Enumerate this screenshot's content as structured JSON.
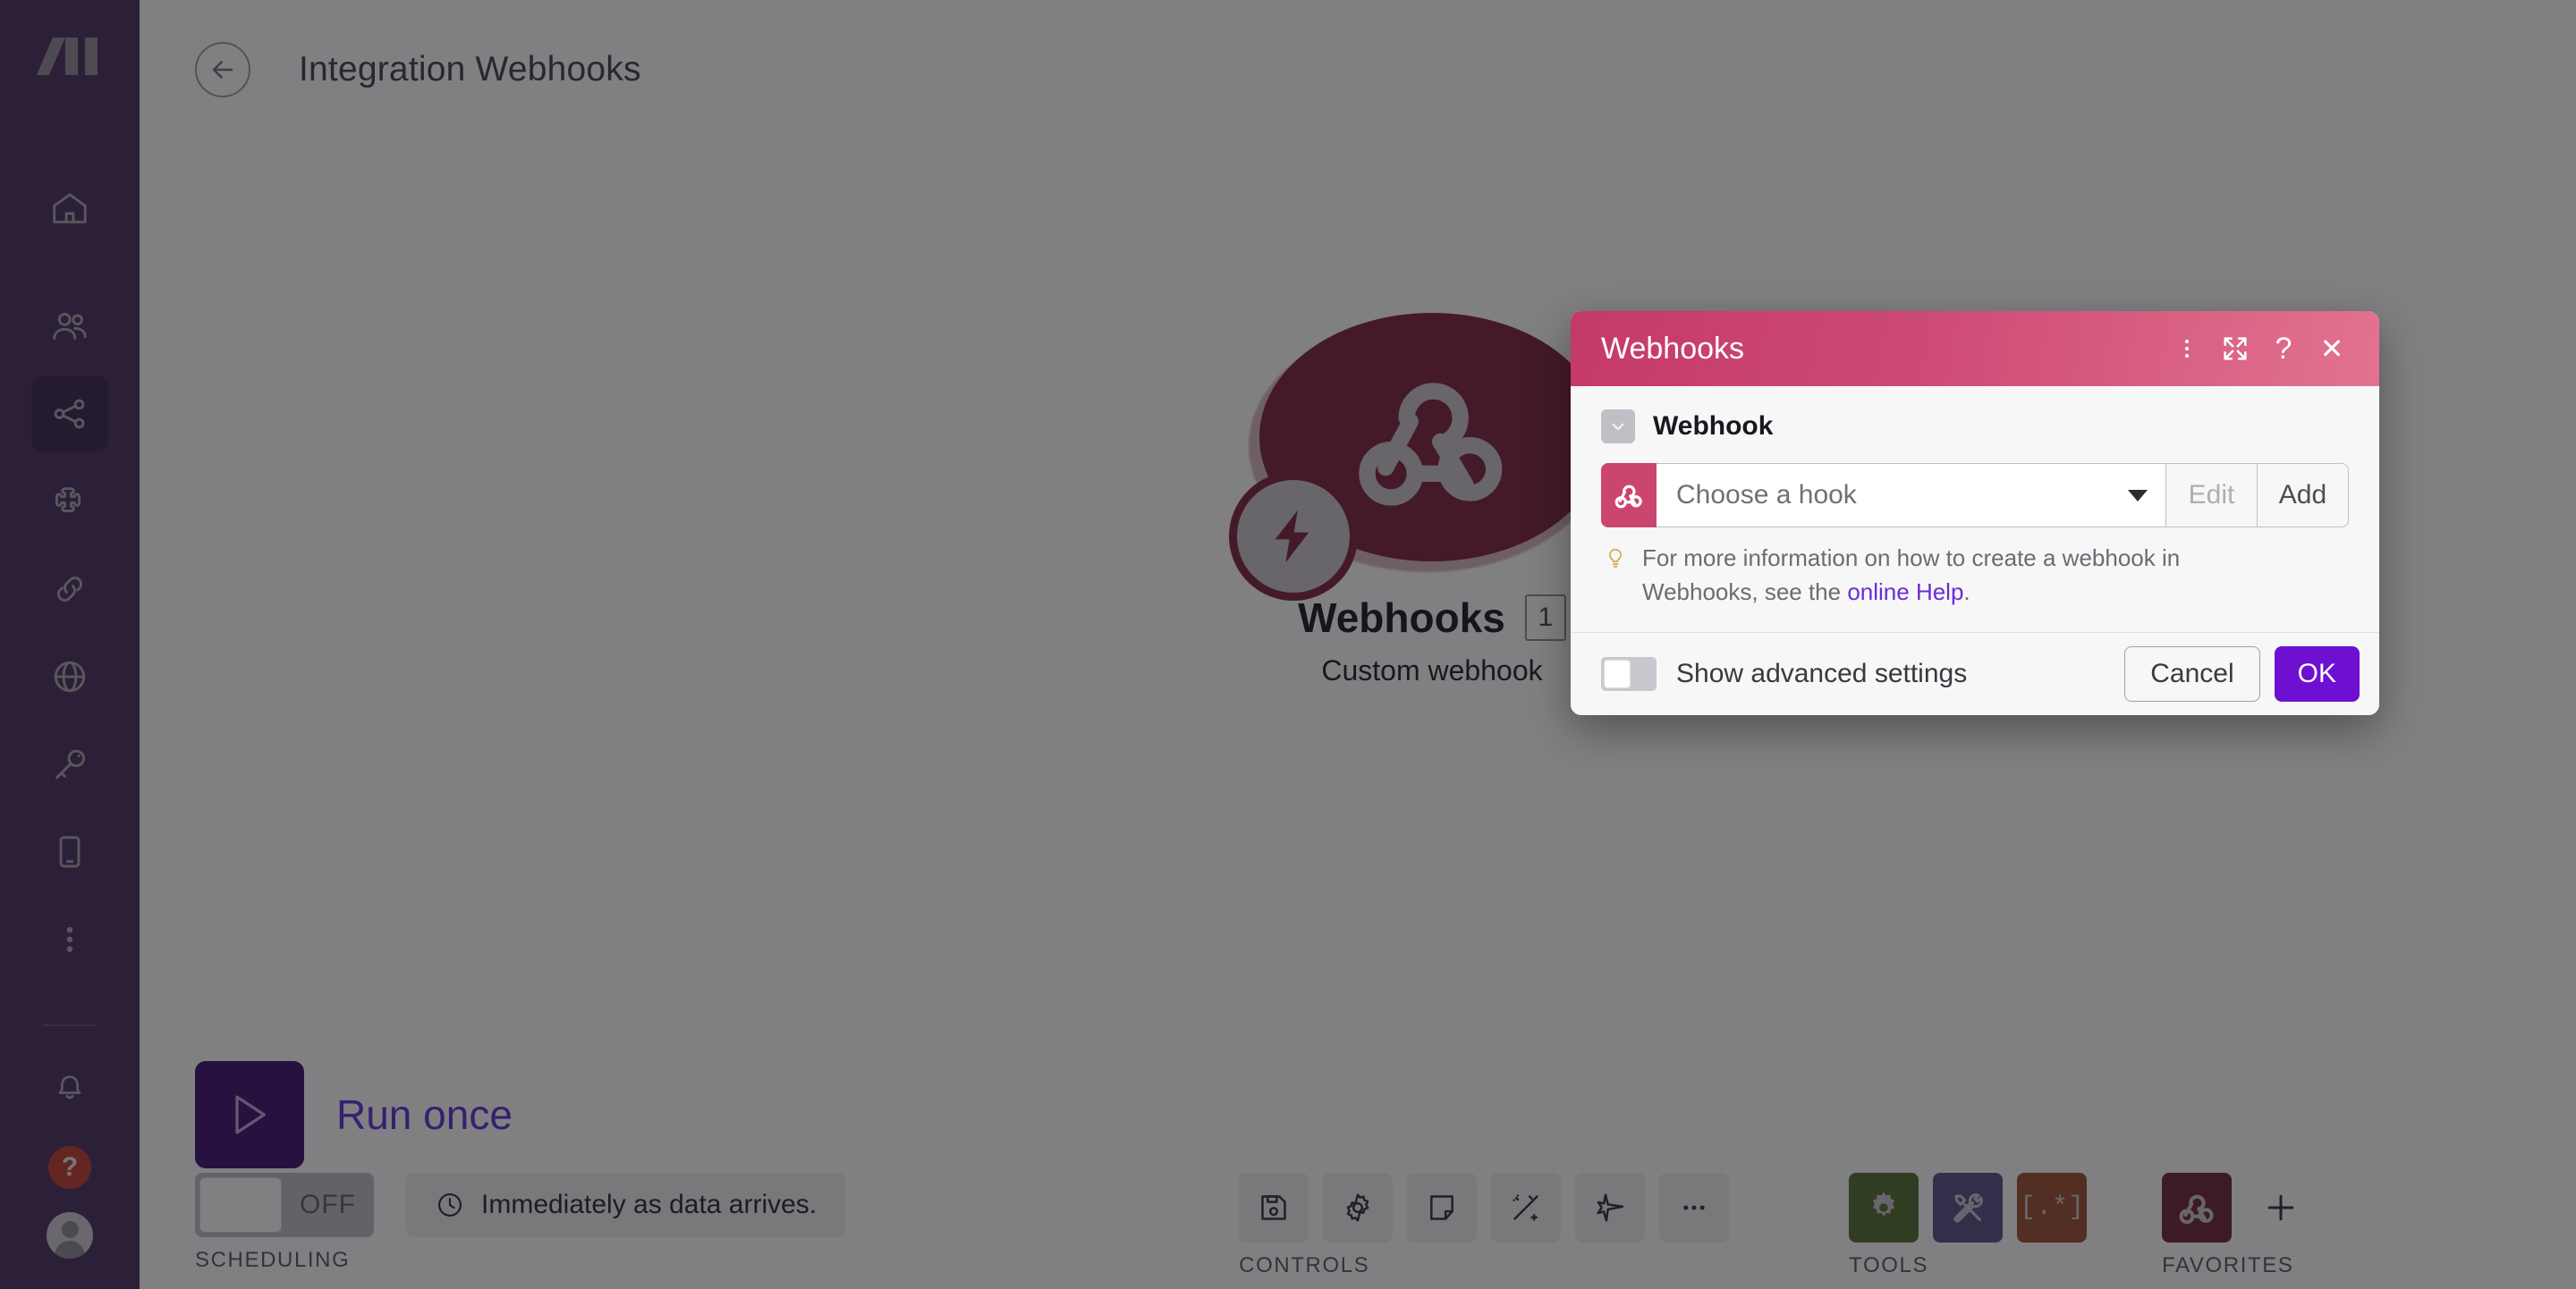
{
  "app": {
    "logo_name": "make-logo",
    "sidebar": {
      "items": [
        {
          "icon": "home-icon",
          "name": "home",
          "active": false
        },
        {
          "icon": "team-icon",
          "name": "team",
          "active": false
        },
        {
          "icon": "scenarios-icon",
          "name": "scenarios",
          "active": true
        },
        {
          "icon": "templates-icon",
          "name": "templates",
          "active": false
        },
        {
          "icon": "connections-icon",
          "name": "connections",
          "active": false
        },
        {
          "icon": "webhooks-icon",
          "name": "webhooks",
          "active": false
        },
        {
          "icon": "keys-icon",
          "name": "keys",
          "active": false
        },
        {
          "icon": "devices-icon",
          "name": "devices",
          "active": false
        },
        {
          "icon": "more-icon",
          "name": "more",
          "active": false
        }
      ],
      "bottom_items": [
        {
          "icon": "bell-icon",
          "name": "notifications"
        },
        {
          "icon": "question-icon",
          "name": "help",
          "label": "?"
        },
        {
          "icon": "avatar-icon",
          "name": "account"
        }
      ]
    }
  },
  "header": {
    "back_icon": "arrow-left-icon",
    "title": "Integration Webhooks"
  },
  "canvas": {
    "node": {
      "title": "Webhooks",
      "subtitle": "Custom webhook",
      "count": "1",
      "icon": "webhook-icon",
      "badge_icon": "instant-trigger-bolt-icon",
      "color": "#7B1E39"
    }
  },
  "bottom_bar": {
    "run_once": {
      "label": "Run once",
      "icon": "play-icon",
      "button_color": "#3A0B6D",
      "label_color": "#5C2AD2"
    },
    "scheduling": {
      "group_label": "SCHEDULING",
      "toggle_state": "OFF",
      "schedule_icon": "clock-icon",
      "schedule_text": "Immediately as data arrives."
    },
    "controls": {
      "group_label": "CONTROLS",
      "items": [
        {
          "icon": "save-icon",
          "name": "save"
        },
        {
          "icon": "gear-icon",
          "name": "scenario-settings"
        },
        {
          "icon": "note-icon",
          "name": "notes"
        },
        {
          "icon": "magic-wand-icon",
          "name": "auto-align"
        },
        {
          "icon": "airplane-icon",
          "name": "explore"
        },
        {
          "icon": "ellipsis-icon",
          "name": "more-controls"
        }
      ]
    },
    "tools": {
      "group_label": "TOOLS",
      "items": [
        {
          "icon": "gear-icon",
          "name": "tools-gear",
          "color": "#4E6B2E"
        },
        {
          "icon": "wrench-screwdriver-icon",
          "name": "tools-utility",
          "color": "#554C85"
        },
        {
          "icon": "regex-icon",
          "name": "tools-text-parser",
          "color": "#9C4A2C",
          "label": "[.*]"
        }
      ]
    },
    "favorites": {
      "group_label": "FAVORITES",
      "items": [
        {
          "icon": "webhook-icon",
          "name": "favorite-webhooks",
          "color": "#6B1F34"
        }
      ],
      "add_icon": "plus-icon"
    }
  },
  "dialog": {
    "title": "Webhooks",
    "header_color": "#CE4B76",
    "header_icons": [
      {
        "icon": "vertical-ellipsis-icon",
        "name": "dialog-menu",
        "glyph": "⋮"
      },
      {
        "icon": "expand-icon",
        "name": "dialog-expand"
      },
      {
        "icon": "question-icon",
        "name": "dialog-help",
        "glyph": "?"
      },
      {
        "icon": "close-icon",
        "name": "dialog-close",
        "glyph": "✕"
      }
    ],
    "section": {
      "title": "Webhook",
      "collapse_icon": "chevron-down-icon"
    },
    "field": {
      "badge_icon": "webhook-icon",
      "badge_color": "#CB466F",
      "placeholder": "Choose a hook",
      "caret_icon": "caret-down-icon",
      "edit_label": "Edit",
      "edit_disabled": true,
      "add_label": "Add"
    },
    "tip": {
      "icon": "lightbulb-icon",
      "text_before": "For more information on how to create a webhook in Webhooks, see the ",
      "link_text": "online Help",
      "text_after": "."
    },
    "footer": {
      "advanced_label": "Show advanced settings",
      "advanced_state": "off",
      "cancel_label": "Cancel",
      "ok_label": "OK",
      "ok_color": "#6D10D2"
    }
  }
}
